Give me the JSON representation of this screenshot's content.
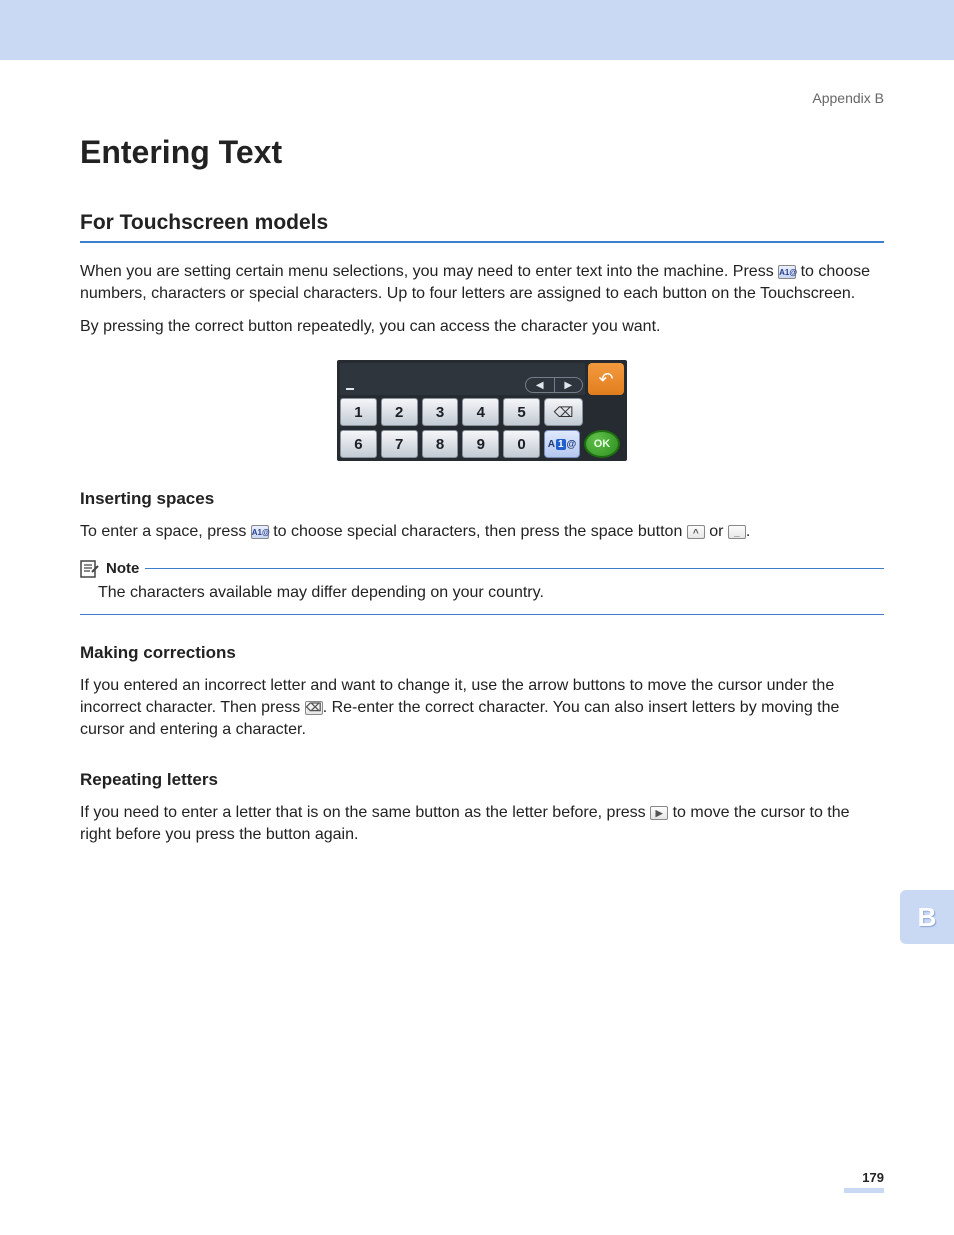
{
  "header_label": "Appendix B",
  "title": "Entering Text",
  "section1_title": "For Touchscreen models",
  "para1": "When you are setting certain menu selections, you may need to enter text into the machine. Press ",
  "para1_after": " to choose numbers, characters or special characters. Up to four letters are assigned to each button on the Touchscreen.",
  "para2": "By pressing the correct button repeatedly, you can access the character you want.",
  "kbd": {
    "keys_row1": [
      "1",
      "2",
      "3",
      "4",
      "5"
    ],
    "keys_row2": [
      "6",
      "7",
      "8",
      "9",
      "0"
    ],
    "back_symbol": "↶",
    "bksp_symbol": "⌫",
    "mode_A": "A",
    "mode_1": "1",
    "mode_at": "@",
    "ok_label": "OK",
    "arrow_left": "◀",
    "arrow_right": "▶"
  },
  "sec_insert_title": "Inserting spaces",
  "sec_insert_p_a": "To enter a space, press ",
  "sec_insert_p_b": " to choose special characters, then press the space button ",
  "sec_insert_p_c": " or ",
  "sec_insert_p_d": ".",
  "note_label": "Note",
  "note_body": "The characters available may differ depending on your country.",
  "sec_corr_title": "Making corrections",
  "sec_corr_p_a": "If you entered an incorrect letter and want to change it, use the arrow buttons to move the cursor under the incorrect character. Then press ",
  "sec_corr_p_b": ". Re-enter the correct character. You can also insert letters by moving the cursor and entering a character.",
  "sec_rep_title": "Repeating letters",
  "sec_rep_p_a": "If you need to enter a letter that is on the same button as the letter before, press ",
  "sec_rep_p_b": " to move the cursor to the right before you press the button again.",
  "side_tab": "B",
  "page_number": "179"
}
